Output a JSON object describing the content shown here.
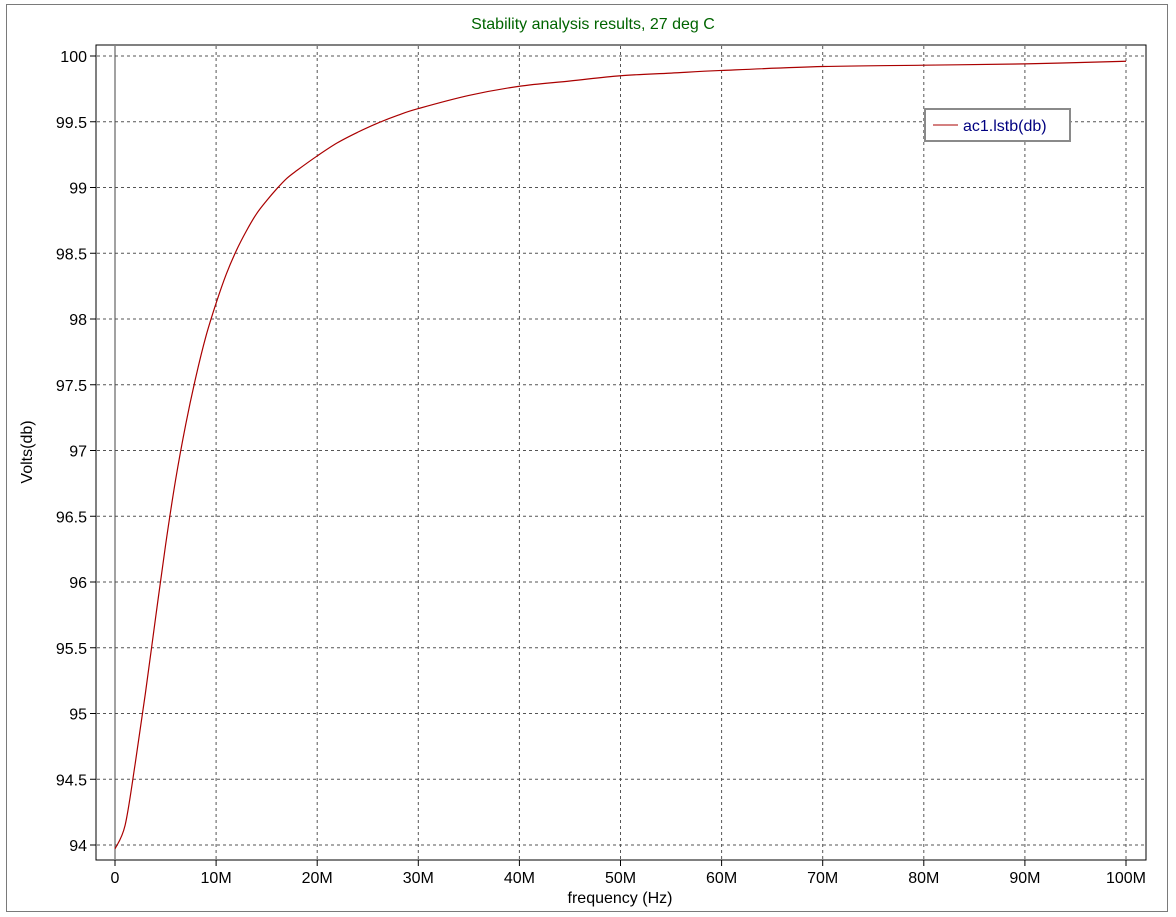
{
  "chart_data": {
    "type": "line",
    "title": "Stability analysis results, 27 deg C",
    "xlabel": "frequency (Hz)",
    "ylabel": "Volts(db)",
    "xlim": [
      0,
      100000000
    ],
    "ylim": [
      94,
      100
    ],
    "x_ticks": [
      {
        "value": 0,
        "label": "0"
      },
      {
        "value": 10000000,
        "label": "10M"
      },
      {
        "value": 20000000,
        "label": "20M"
      },
      {
        "value": 30000000,
        "label": "30M"
      },
      {
        "value": 40000000,
        "label": "40M"
      },
      {
        "value": 50000000,
        "label": "50M"
      },
      {
        "value": 60000000,
        "label": "60M"
      },
      {
        "value": 70000000,
        "label": "70M"
      },
      {
        "value": 80000000,
        "label": "80M"
      },
      {
        "value": 90000000,
        "label": "90M"
      },
      {
        "value": 100000000,
        "label": "100M"
      }
    ],
    "y_ticks": [
      {
        "value": 94,
        "label": "94"
      },
      {
        "value": 94.5,
        "label": "94.5"
      },
      {
        "value": 95,
        "label": "95"
      },
      {
        "value": 95.5,
        "label": "95.5"
      },
      {
        "value": 96,
        "label": "96"
      },
      {
        "value": 96.5,
        "label": "96.5"
      },
      {
        "value": 97,
        "label": "97"
      },
      {
        "value": 97.5,
        "label": "97.5"
      },
      {
        "value": 98,
        "label": "98"
      },
      {
        "value": 98.5,
        "label": "98.5"
      },
      {
        "value": 99,
        "label": "99"
      },
      {
        "value": 99.5,
        "label": "99.5"
      },
      {
        "value": 100,
        "label": "100"
      }
    ],
    "grid": true,
    "legend_position": "top-right",
    "series": [
      {
        "name": "ac1.lstb(db)",
        "color": "#aa0000",
        "x": [
          0,
          1000000,
          2000000,
          3000000,
          4000000,
          5000000,
          6000000,
          7000000,
          8000000,
          9000000,
          10000000,
          11000000,
          12000000,
          13000000,
          14000000,
          15000000,
          16000000,
          17000000,
          18000000,
          20000000,
          22000000,
          24000000,
          26000000,
          28000000,
          30000000,
          35000000,
          40000000,
          45000000,
          50000000,
          55000000,
          60000000,
          70000000,
          80000000,
          90000000,
          100000000
        ],
        "y": [
          93.97,
          94.15,
          94.62,
          95.15,
          95.72,
          96.28,
          96.78,
          97.2,
          97.56,
          97.87,
          98.12,
          98.34,
          98.52,
          98.67,
          98.8,
          98.9,
          98.99,
          99.07,
          99.13,
          99.24,
          99.34,
          99.42,
          99.49,
          99.55,
          99.6,
          99.7,
          99.77,
          99.81,
          99.85,
          99.87,
          99.89,
          99.92,
          99.93,
          99.94,
          99.96
        ]
      }
    ]
  },
  "colors": {
    "title": "#006400",
    "legend_text": "#000080",
    "grid": "#555555",
    "frame": "#7a7a7a"
  }
}
